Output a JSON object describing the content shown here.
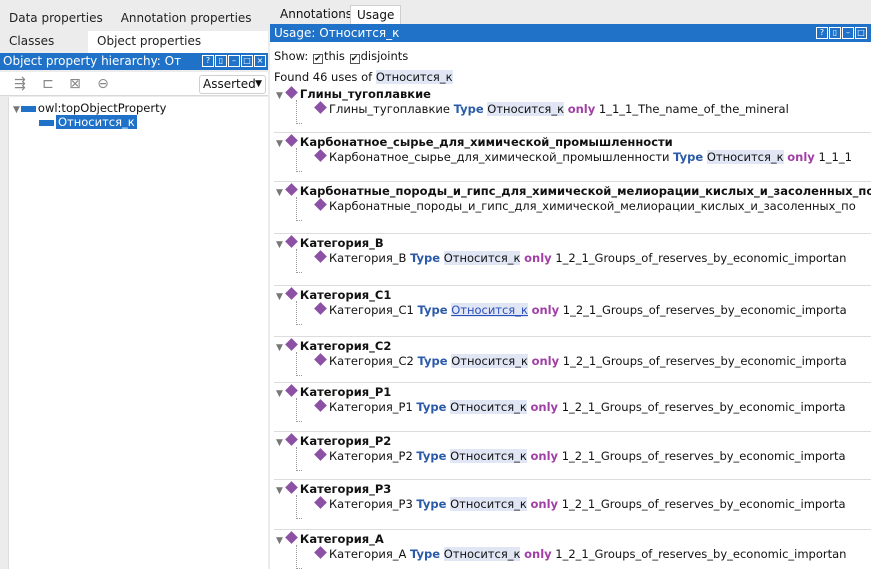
{
  "left": {
    "tabs_row1": [
      "Data properties",
      "Annotation properties"
    ],
    "tabs_row2": [
      "Classes",
      "Object properties"
    ],
    "hierarchy_title": "Object property hierarchy: От",
    "asserted": "Asserted",
    "tree": {
      "root": "owl:topObjectProperty",
      "child": "Относится_к"
    }
  },
  "right": {
    "tabs": [
      "Annotations",
      "Usage"
    ],
    "usage_title": "Usage: Относится_к",
    "show_label": "Show:",
    "this_label": "this",
    "disjoints_label": "disjoints",
    "found_prefix": "Found 46 uses of",
    "property": "Относится_к",
    "type_kw": "Type",
    "only_kw": "only",
    "blocks": [
      {
        "name": "Глины_тугоплавкие",
        "filler": "1_1_1_The_name_of_the_mineral"
      },
      {
        "name": "Карбонатное_сырье_для_химической_промышленности",
        "filler": "1_1_1"
      },
      {
        "name": "Карбонатные_породы_и_гипс_для_химической_мелиорации_кислых_и_засоленных_по",
        "filler": ""
      },
      {
        "name": "Категория_B",
        "filler": "1_2_1_Groups_of_reserves_by_economic_importan"
      },
      {
        "name": "Категория_C1",
        "filler": "1_2_1_Groups_of_reserves_by_economic_importa"
      },
      {
        "name": "Категория_C2",
        "filler": "1_2_1_Groups_of_reserves_by_economic_importa"
      },
      {
        "name": "Категория_P1",
        "filler": "1_2_1_Groups_of_reserves_by_economic_importa"
      },
      {
        "name": "Категория_P2",
        "filler": "1_2_1_Groups_of_reserves_by_economic_importa"
      },
      {
        "name": "Категория_P3",
        "filler": "1_2_1_Groups_of_reserves_by_economic_importa"
      },
      {
        "name": "Категория_A",
        "filler": "1_2_1_Groups_of_reserves_by_economic_importan"
      }
    ],
    "colors": {
      "accent": "#1f72c7",
      "individual": "#8c51a5",
      "type": "#2a5aa8",
      "only": "#a13fa6"
    }
  }
}
